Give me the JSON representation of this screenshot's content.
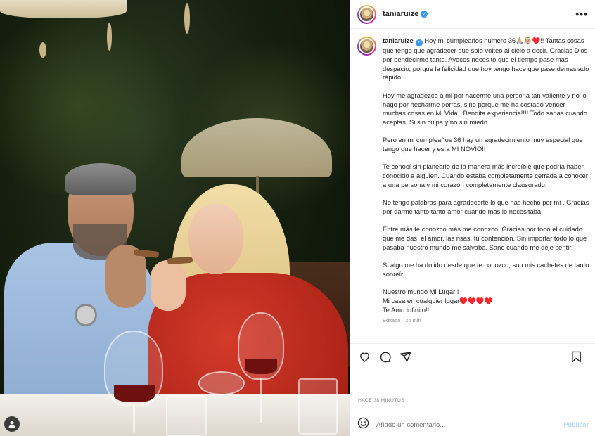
{
  "post": {
    "username": "taniaruize",
    "more_label": "•••",
    "caption_user": "taniaruize",
    "caption_paragraphs": [
      "Hoy mi cumpleaños número 36🙏🏼👰🏼♥️!! Tantas cosas que tengo que agradecer que solo volteo al cielo a decir. Gracias Dios por bendecirme tanto. Aveces necesito que el tiempo pase mas despacio, porque la felicidad que hoy tengo hace que pase demasiado rápido.",
      "Hoy me agradezco a mi por hacerme una persona tan valiente y no lo hago por hecharme porras, sino porque me ha costado vencer muchas cosas en Mi Vida . Bendita experiencia!!!! Todo sanas cuando aceptas. Si sin culpa y no sin miedo.",
      "Pero en mi cumpleaños 36 hay un agradecimiento muy especial que tengo que hacer y es a MI NOVIO!!",
      "Te conocí sin planearlo de la manera más increíble que podría haber conocido a alguien. Cuando estaba completamente cerrada a conocer a una persona y mi corazón completamente clausurado.",
      "No tengo palabras para agradecerte lo que has hecho por mi . Gracias por darme tanto tanto amor cuando mas lo necesitaba.",
      "Entre más te conozco más me conozco. Gracias por todo el cuidado que me das, el amor, las risas, tu contención. Sin importar todo lo que pasaba nuestro mundo me salvaba. Sane cuando me deje sentir.",
      "Si algo me ha dolido desde que te conozco, son mis cachetes de tanto sonreír."
    ],
    "closing_lines": [
      "Nuestro mundo Mi Lugar!!",
      "Mi casa en cualquier lugar♥️♥️♥️♥️",
      "Te Amo infinito!!!"
    ],
    "edited_label": "Editado · 24 min",
    "time_ago": "HACE 38 MINUTOS"
  },
  "actions": {
    "like_icon": "heart-icon",
    "comment_icon": "comment-icon",
    "share_icon": "share-icon",
    "save_icon": "bookmark-icon"
  },
  "comment_box": {
    "emoji_icon": "emoji-icon",
    "placeholder": "Añade un comentario...",
    "publish_label": "Publicar"
  },
  "colors": {
    "verified": "#3897f0",
    "publish_disabled": "#b3dbff",
    "muted_text": "#8e8e8e"
  }
}
